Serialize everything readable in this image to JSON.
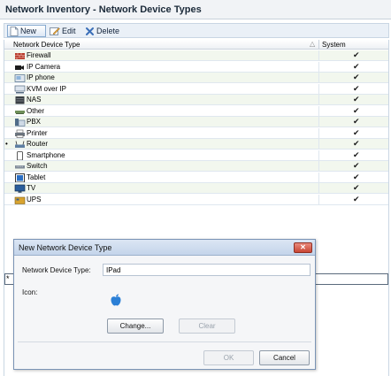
{
  "window": {
    "title": "Network Inventory - Network Device Types"
  },
  "toolbar": {
    "new_label": "New",
    "edit_label": "Edit",
    "delete_label": "Delete"
  },
  "grid": {
    "columns": {
      "type": "Network Device Type",
      "system": "System"
    },
    "sort_glyph": "△",
    "rows": [
      {
        "label": "Firewall",
        "icon": "firewall-icon",
        "system": "✔",
        "current": ""
      },
      {
        "label": "IP Camera",
        "icon": "camera-icon",
        "system": "✔",
        "current": ""
      },
      {
        "label": "IP phone",
        "icon": "phone-icon",
        "system": "✔",
        "current": ""
      },
      {
        "label": "KVM over IP",
        "icon": "kvm-icon",
        "system": "✔",
        "current": ""
      },
      {
        "label": "NAS",
        "icon": "nas-icon",
        "system": "✔",
        "current": ""
      },
      {
        "label": "Other",
        "icon": "other-device-icon",
        "system": "✔",
        "current": ""
      },
      {
        "label": "PBX",
        "icon": "pbx-icon",
        "system": "✔",
        "current": ""
      },
      {
        "label": "Printer",
        "icon": "printer-icon",
        "system": "✔",
        "current": ""
      },
      {
        "label": "Router",
        "icon": "router-icon",
        "system": "✔",
        "current": "•"
      },
      {
        "label": "Smartphone",
        "icon": "smartphone-icon",
        "system": "✔",
        "current": ""
      },
      {
        "label": "Switch",
        "icon": "switch-icon",
        "system": "✔",
        "current": ""
      },
      {
        "label": "Tablet",
        "icon": "tablet-icon",
        "system": "✔",
        "current": ""
      },
      {
        "label": "TV",
        "icon": "tv-icon",
        "system": "✔",
        "current": ""
      },
      {
        "label": "UPS",
        "icon": "ups-icon",
        "system": "✔",
        "current": ""
      }
    ],
    "new_row_marker": "*"
  },
  "dialog": {
    "title": "New Network Device Type",
    "close_label": "✕",
    "type_label": "Network Device Type:",
    "type_value": "IPad",
    "icon_label": "Icon:",
    "icon": "apple-icon",
    "change_label": "Change...",
    "clear_label": "Clear",
    "ok_label": "OK",
    "cancel_label": "Cancel"
  },
  "colors": {
    "accent": "#1e5fa8",
    "row_alt": "#f2f7ee",
    "close": "#c94533"
  }
}
